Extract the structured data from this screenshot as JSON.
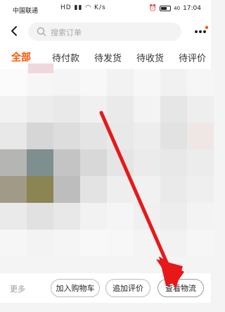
{
  "status_bar": {
    "carrier": "中国联通",
    "signal_icons": "HD ▮▮ ◠ K/s",
    "alarm": "⏰",
    "battery_pct": "40",
    "time": "17:04"
  },
  "nav": {
    "search_placeholder": "搜索订单"
  },
  "tabs": [
    {
      "label": "全部",
      "active": true
    },
    {
      "label": "待付款",
      "active": false
    },
    {
      "label": "待发货",
      "active": false
    },
    {
      "label": "待收货",
      "active": false
    },
    {
      "label": "待评价",
      "active": false
    }
  ],
  "actions": {
    "more": "更多",
    "add_to_cart": "加入购物车",
    "add_review": "追加评价",
    "view_logistics": "查看物流"
  },
  "colors": {
    "accent": "#ff5500",
    "arrow": "#e81818"
  },
  "icons": {
    "back": "back-icon",
    "search": "search-icon",
    "more": "more-icon"
  }
}
